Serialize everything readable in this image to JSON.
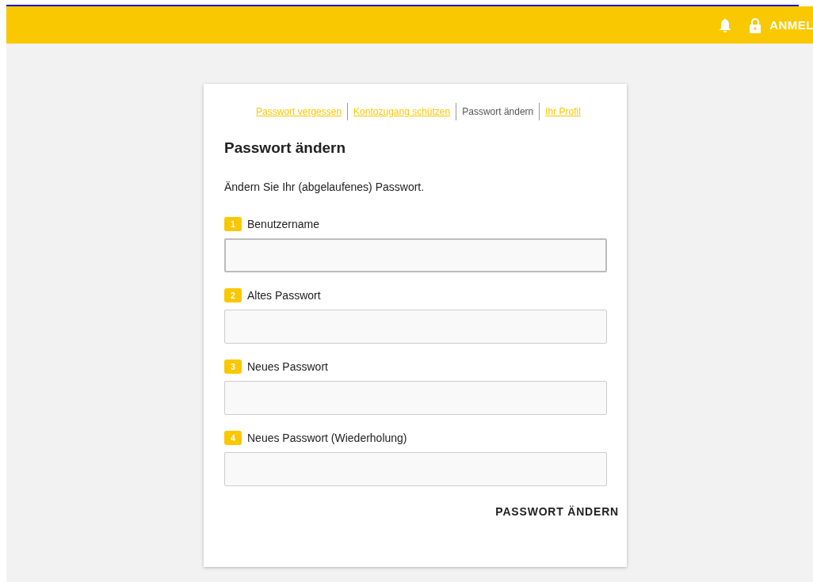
{
  "header": {
    "login_label": "ANMEL"
  },
  "tabs": [
    {
      "label": "Passwort vergessen",
      "selected": false
    },
    {
      "label": "Kontozugang schützen",
      "selected": false
    },
    {
      "label": "Passwort ändern",
      "selected": true
    },
    {
      "label": "Ihr Profil",
      "selected": false
    }
  ],
  "title": "Passwort ändern",
  "description": "Ändern Sie Ihr (abgelaufenes) Passwort.",
  "fields": [
    {
      "step": "1",
      "label": "Benutzername",
      "focused": true
    },
    {
      "step": "2",
      "label": "Altes Passwort",
      "focused": false
    },
    {
      "step": "3",
      "label": "Neues Passwort",
      "focused": false
    },
    {
      "step": "4",
      "label": "Neues Passwort (Wiederholung)",
      "focused": false
    }
  ],
  "submit": "PASSWORT ÄNDERN"
}
